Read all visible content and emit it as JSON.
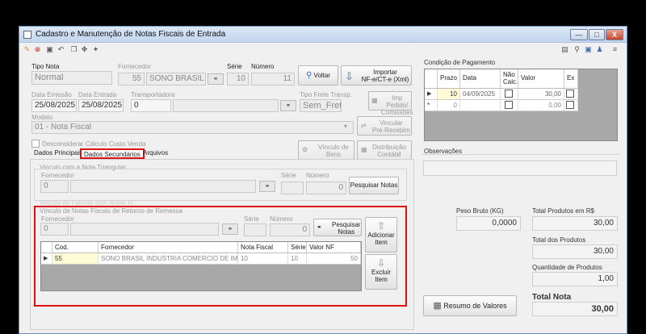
{
  "window": {
    "title": "Cadastro e Manutenção de Notas Fiscais de Entrada"
  },
  "controls": {
    "minimize": "—",
    "maximize": "□",
    "close": "X"
  },
  "header": {
    "tipo_nota_label": "Tipo Nota",
    "tipo_nota_value": "Normal",
    "fornecedor_label": "Fornecedor",
    "fornecedor_code": "55",
    "fornecedor_name": "SONO BRASIL IN",
    "serie_label": "Série",
    "serie_value": "10",
    "numero_label": "Número",
    "numero_value": "11",
    "voltar_label": "Voltar",
    "importar_line1": "Importar",
    "importar_line2": "NF-e/CT-e (Xml)",
    "data_emissao_label": "Data Emissão",
    "data_emissao_value": "25/08/2025",
    "data_entrada_label": "Data Entrada",
    "data_entrada_value": "25/08/2025",
    "transportadora_label": "Transportadora",
    "transportadora_value": "0",
    "tipo_frete_label": "Tipo Frete Transp.",
    "tipo_frete_value": "Sem_Frete",
    "imp_pedido_line1": "Imp Pedido/",
    "imp_pedido_line2": "Comissões",
    "modelo_label": "Modelo",
    "modelo_value": "01 - Nota Fiscal",
    "vincular_line1": "Vincular",
    "vincular_line2": "Pré-Recebim",
    "desconsiderar_label": "Desconsiderar Cálculo Custo Venda",
    "vinculo_bens_line1": "Vínculo de",
    "vinculo_bens_line2": "Bens",
    "distribuicao_line1": "Distribuição",
    "distribuicao_line2": "Contábil"
  },
  "tabs": [
    "Dados Principais",
    "Dados Secundários",
    "Arquivos"
  ],
  "triangular": {
    "title": "Vinculo com a Nota Triangular",
    "fornecedor_label": "Fornecedor",
    "fornecedor_value": "0",
    "serie_label": "Série",
    "numero_label": "Número",
    "numero_value": "0",
    "pesquisar_label": "Pesquisar Notas"
  },
  "remessa_hidden_title": "Vinculo de Faturas com Notas R...",
  "remessa": {
    "title": "Vínculo de Notas Fiscais de Retorno de Remessa",
    "fornecedor_label": "Fornecedor",
    "fornecedor_value": "0",
    "serie_label": "Série",
    "numero_label": "Número",
    "numero_value": "0",
    "pesquisar_line1": "Pesquisar",
    "pesquisar_line2": "Notas",
    "adicionar_line1": "Adicionar",
    "adicionar_line2": "Item",
    "excluir_line1": "Excluir",
    "excluir_line2": "Item",
    "columns": [
      "Cod.",
      "Fornecedor",
      "Nota Fiscal",
      "Série",
      "Valor NF"
    ],
    "rows": [
      {
        "cod": "55",
        "fornecedor": "SONO BRASIL INDUSTRIA COMERCIO DE IM...",
        "nota": "10",
        "serie": "10",
        "valor": "50"
      }
    ]
  },
  "pagamento": {
    "title": "Condição de Pagamento",
    "columns": [
      "Prazo",
      "Data",
      "Não Calc.",
      "Valor",
      "Ex"
    ],
    "rows": [
      {
        "marker": "▶",
        "prazo": "10",
        "data": "04/09/2025",
        "valor": "30,00"
      },
      {
        "marker": "*",
        "prazo": "0",
        "data": "",
        "valor": "0,00"
      }
    ]
  },
  "observacoes_label": "Observações",
  "totais": {
    "peso_label": "Peso Bruto (KG)",
    "peso_value": "0,0000",
    "total_produtos_rs_label": "Total Produtos em R$",
    "total_produtos_rs_value": "30,00",
    "total_produtos_label": "Total dos Produtos",
    "total_produtos_value": "30,00",
    "quantidade_label": "Quantidade de Produtos",
    "quantidade_value": "1,00",
    "total_nota_label": "Total Nota",
    "total_nota_value": "30,00",
    "resumo_label": "Resumo de Valores"
  }
}
